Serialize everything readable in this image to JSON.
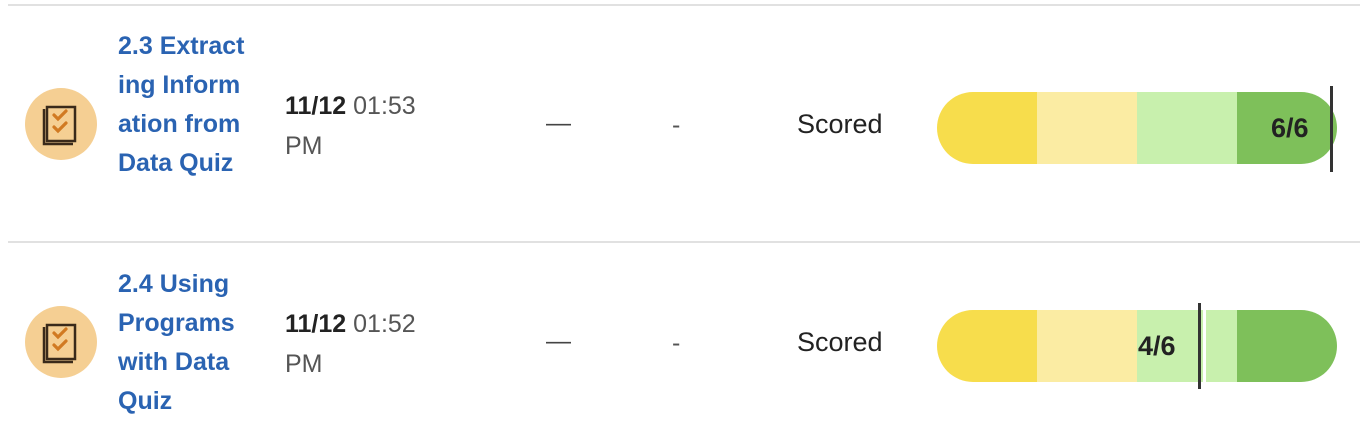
{
  "rows": [
    {
      "title": "2.3 Extracting Information from Data Quiz",
      "icon": "quiz-checklist-icon",
      "date": "11/12",
      "time": "01:53",
      "meridiem": "PM",
      "dash": "—",
      "hyphen": "-",
      "status": "Scored",
      "score": "6/6",
      "score_fraction": 1.0
    },
    {
      "title": "2.4 Using Programs with Data Quiz",
      "icon": "quiz-checklist-icon",
      "date": "11/12",
      "time": "01:52",
      "meridiem": "PM",
      "dash": "—",
      "hyphen": "-",
      "status": "Scored",
      "score": "4/6",
      "score_fraction": 0.6667
    }
  ],
  "colors": {
    "link": "#2a63b2",
    "icon_bg": "#f5cf93",
    "icon_accent": "#d17a22",
    "score_seg_1": "#f7dd4c",
    "score_seg_2": "#fbeca3",
    "score_seg_3": "#c8f0ad",
    "score_seg_4": "#7ec05a"
  }
}
